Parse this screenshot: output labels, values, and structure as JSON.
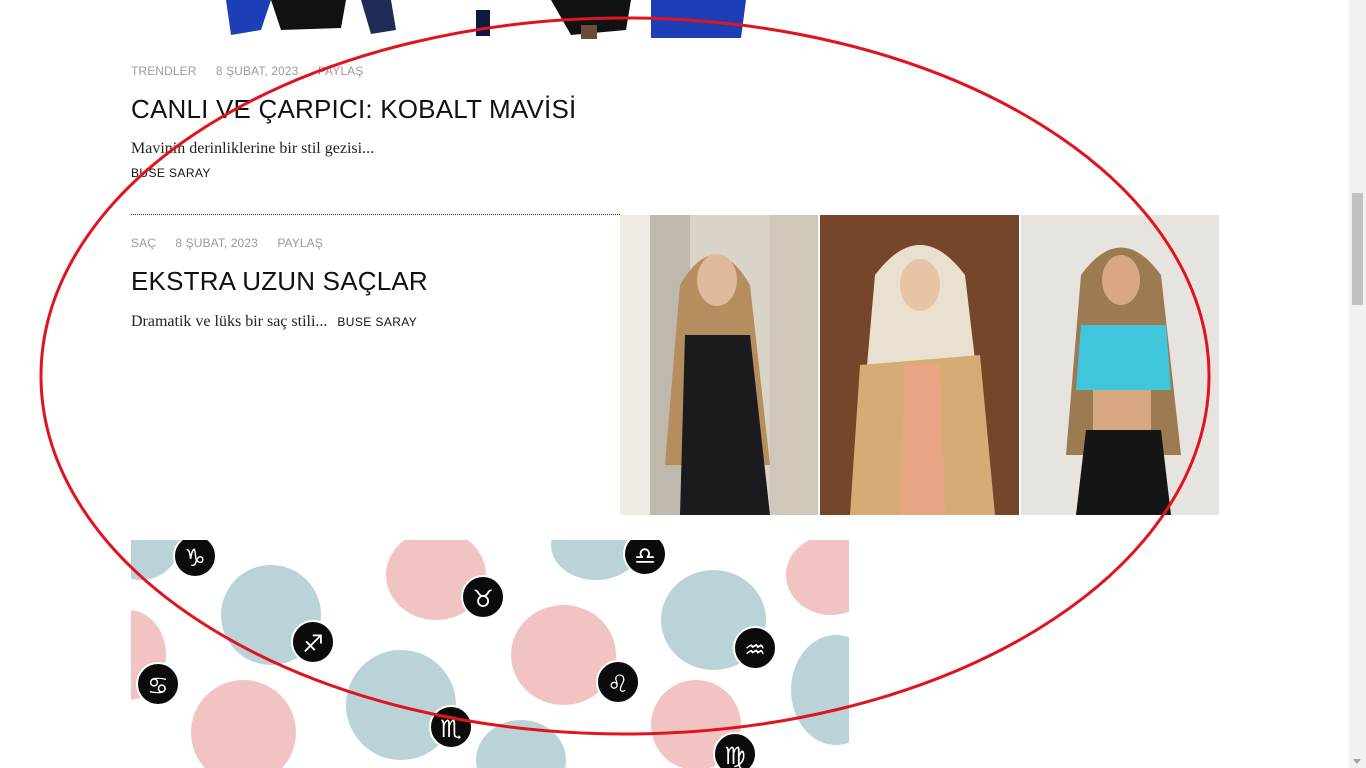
{
  "post1": {
    "category": "TRENDLER",
    "date": "8 ŞUBAT, 2023",
    "share": "PAYLAŞ",
    "title": "CANLI VE ÇARPICI: KOBALT MAVİSİ",
    "excerpt": "Mavinin derinliklerine bir stil gezisi...",
    "author": "BUSE SARAY"
  },
  "post2": {
    "category": "SAÇ",
    "date": "8 ŞUBAT, 2023",
    "share": "PAYLAŞ",
    "title": "EKSTRA UZUN SAÇLAR",
    "excerpt": "Dramatik ve lüks bir saç stili...",
    "author": "BUSE SARAY"
  },
  "zodiac_signs": [
    "♑",
    "♉",
    "♎",
    "♐",
    "♋",
    "♌",
    "♒",
    "♏",
    "♍"
  ],
  "colors": {
    "annotation_red": "#e0141e",
    "cobalt": "#1c3fb8",
    "face_pink": "#f2c3c3",
    "face_blue": "#b9d3d9"
  }
}
